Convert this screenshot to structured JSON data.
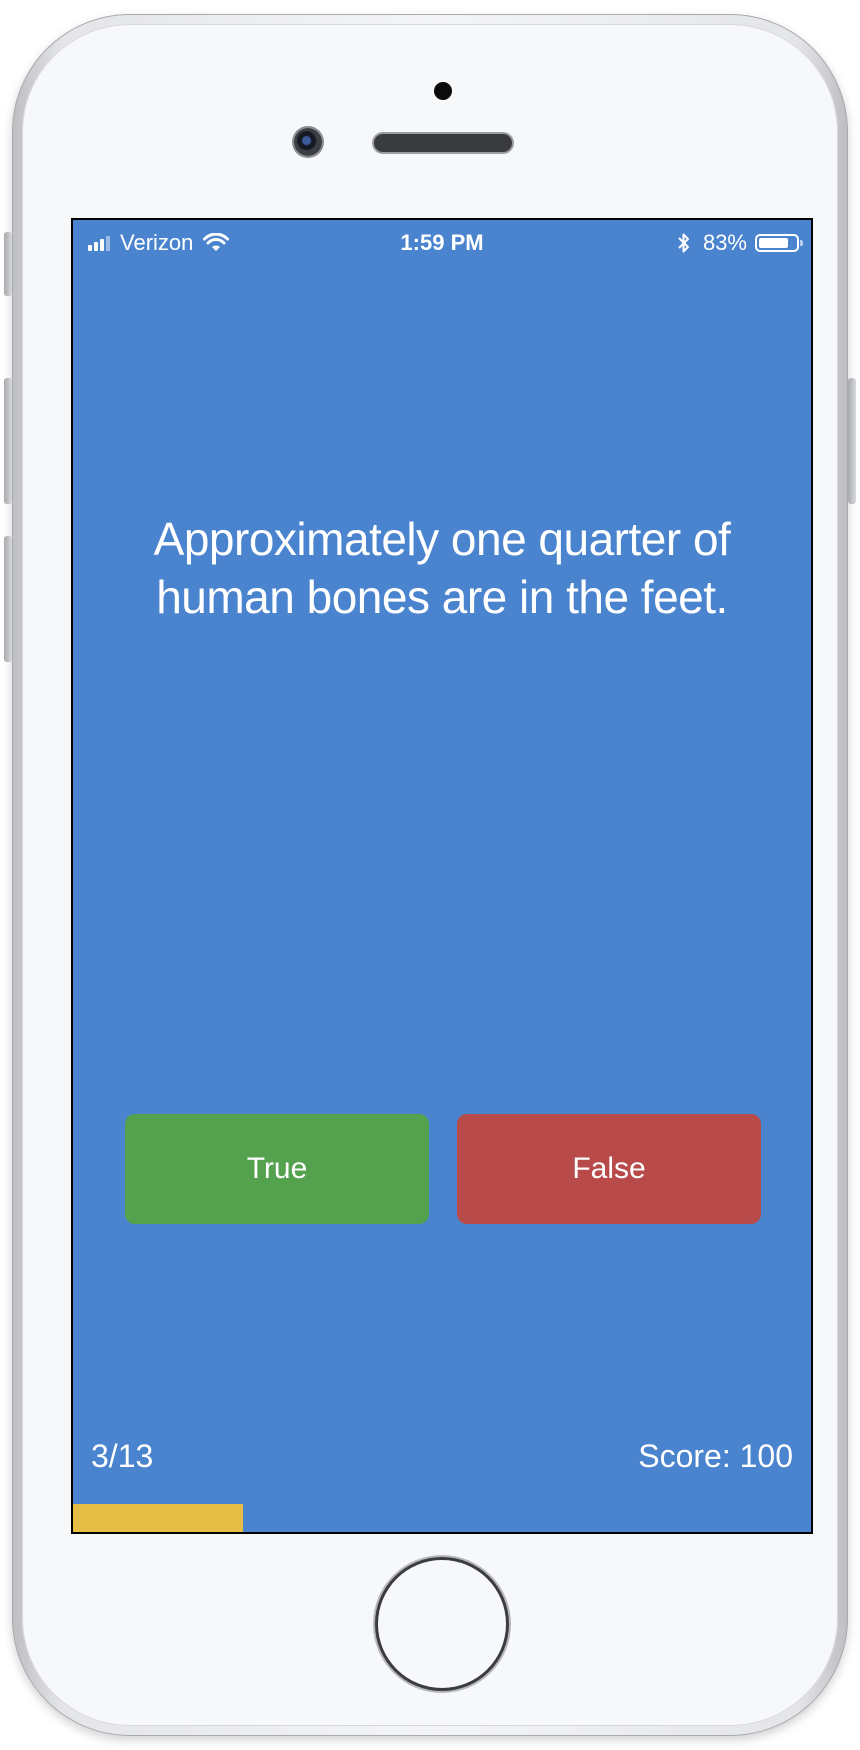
{
  "status_bar": {
    "carrier": "Verizon",
    "time": "1:59 PM",
    "battery_percent": "83%",
    "battery_level": 0.83,
    "icons": [
      "signal-icon",
      "wifi-icon",
      "bluetooth-icon",
      "battery-icon"
    ]
  },
  "quiz": {
    "question": "Approximately one quarter of human bones are in the feet.",
    "true_label": "True",
    "false_label": "False",
    "progress_text": "3/13",
    "score_text": "Score: 100",
    "progress_fraction": 0.23
  },
  "colors": {
    "background": "#4a83ce",
    "true_button": "#54a14e",
    "false_button": "#b94a4a",
    "progress_bar": "#e6bd45"
  }
}
